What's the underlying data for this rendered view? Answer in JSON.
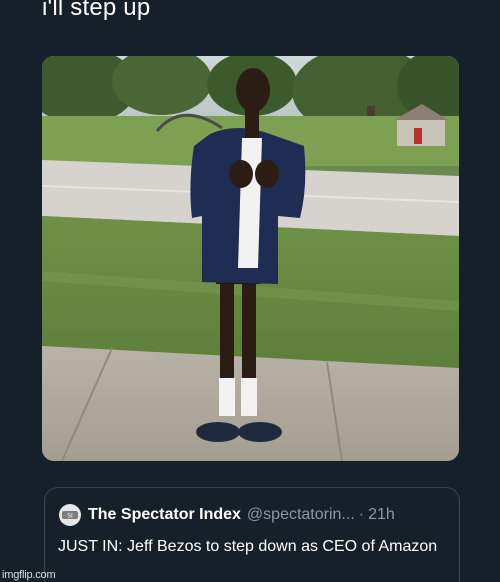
{
  "tweet": {
    "text": "i'll step up"
  },
  "quoted_tweet": {
    "author_name": "The Spectator Index",
    "author_handle": "@spectatorin...",
    "separator": "·",
    "time": "21h",
    "body": "JUST IN: Jeff Bezos to step down as CEO of Amazon",
    "avatar_icon": "spectator-logo-icon"
  },
  "watermark": {
    "text": "imgflip.com"
  },
  "media": {
    "description_icon": "photo-image"
  }
}
